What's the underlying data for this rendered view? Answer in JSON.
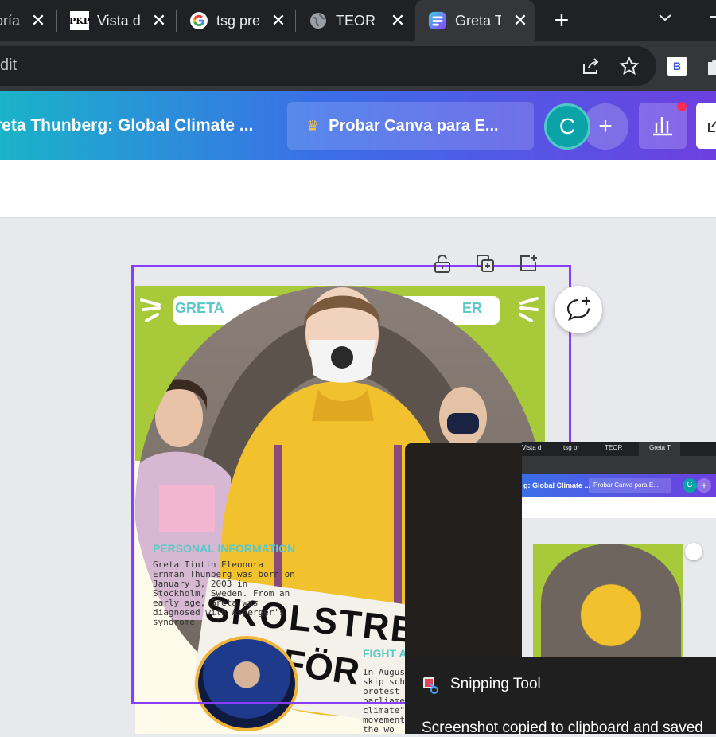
{
  "browser": {
    "tabs": [
      {
        "label": "oría",
        "active": false
      },
      {
        "label": "Vista d",
        "active": false
      },
      {
        "label": "tsg pre",
        "active": false
      },
      {
        "label": "TEOR",
        "active": false
      },
      {
        "label": "Greta T",
        "active": true
      }
    ],
    "new_tab": "+",
    "address_text": "dit",
    "extension_badge": "B"
  },
  "canva": {
    "doc_title": "reta Thunberg: Global Climate ...",
    "try_button": "Probar Canva para E...",
    "avatar_letter": "C",
    "add_button": "+"
  },
  "design": {
    "title_left": "GRETA",
    "title_right": "ER",
    "personal_heading": "PERSONAL INFORMATION",
    "bio_text": "Greta Tintin Eleonora Ernman Thunberg was born on January 3, 2003 in Stockholm, Sweden. From an early age, Greta was diagnosed with Asperger's syndrome",
    "fight_heading": "FIGHT A",
    "august_text": "In August skip sch protest parliamen climate\" movement the wo",
    "sign_line1": "SKOLSTRE",
    "sign_line2": "FÖR"
  },
  "thumbnail": {
    "tab1": "Vista d",
    "tab2": "tsg pr",
    "tab3": "TEOR",
    "tab4": "Greta T",
    "doc_title": "g: Global Climate ...",
    "try_button": "Probar Canva para E...",
    "avatar_letter": "C",
    "add_button": "+"
  },
  "notification": {
    "app_name": "Snipping Tool",
    "message": "Screenshot copied to clipboard and saved"
  },
  "colors": {
    "accent": "#8b3dff",
    "green_band": "#a7c93a",
    "teal_text": "#5cc8c8"
  }
}
